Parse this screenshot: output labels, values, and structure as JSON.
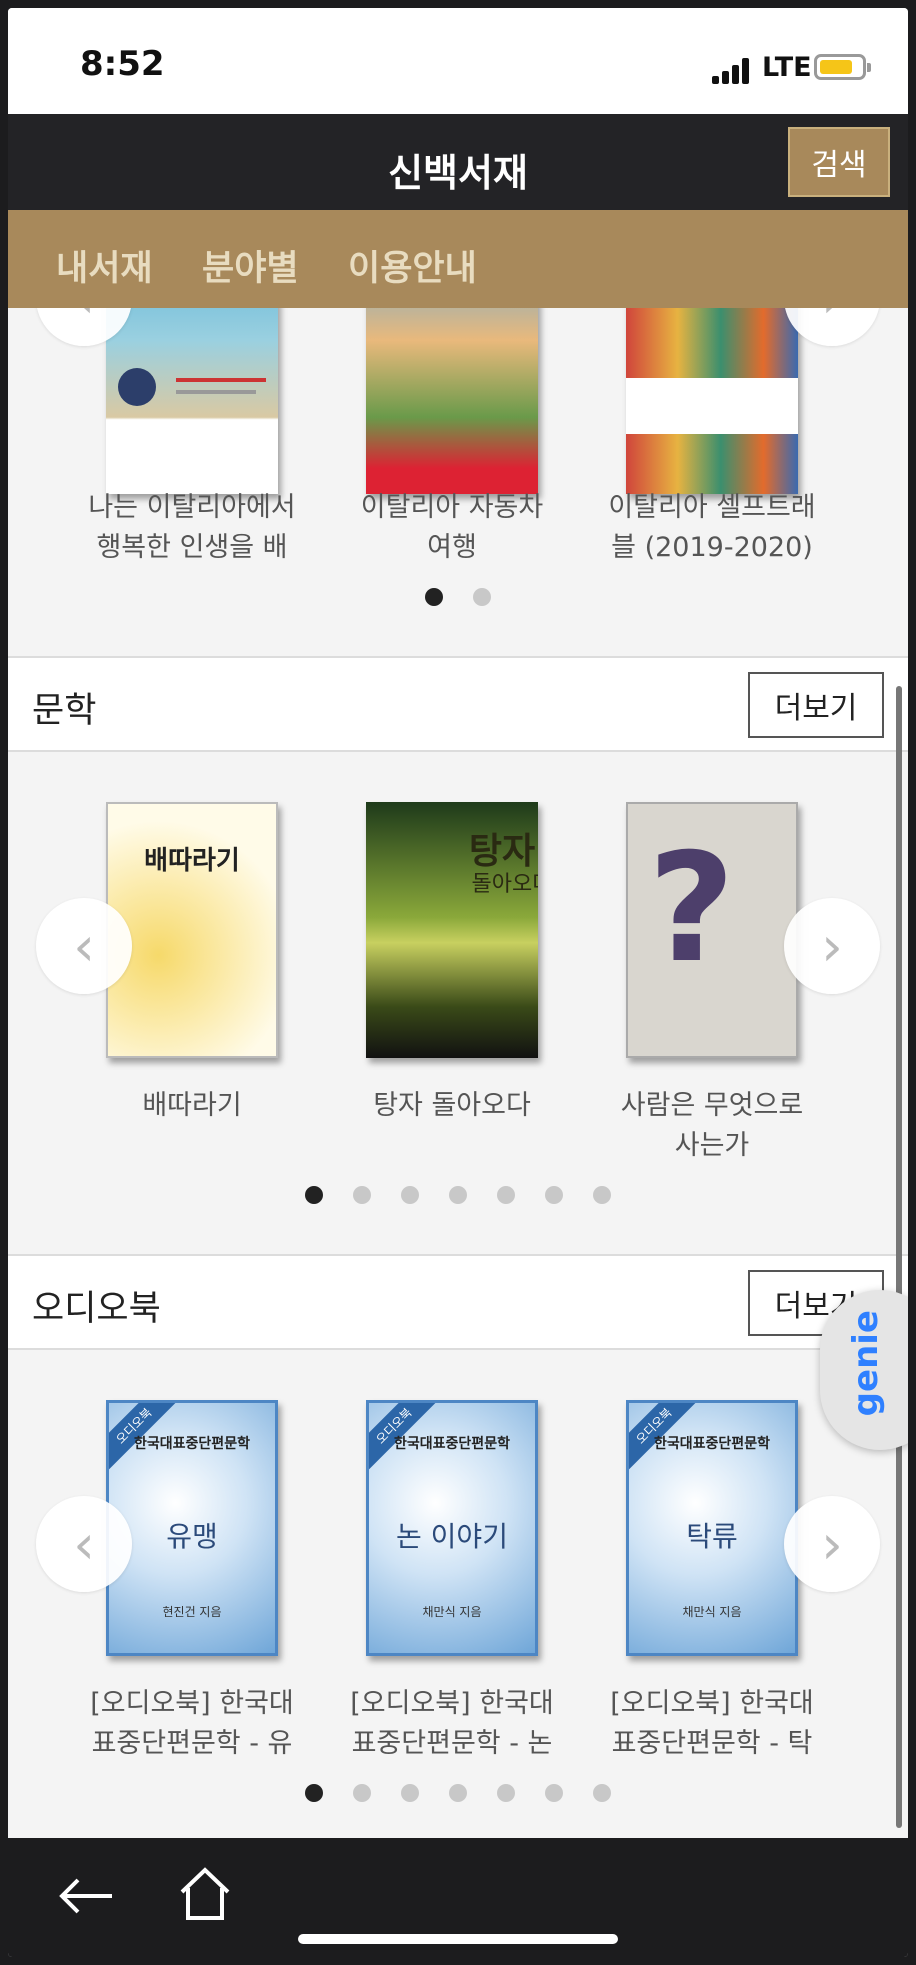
{
  "status_bar": {
    "time": "8:52",
    "network": "LTE"
  },
  "app": {
    "title": "신백서재",
    "search_label": "검색"
  },
  "menu": {
    "items": [
      "내서재",
      "분야별",
      "이용안내"
    ]
  },
  "top_carousel": {
    "books": [
      {
        "caption_line1": "나는 이탈리아에서",
        "caption_line2": "행복한 인생을 배"
      },
      {
        "caption_line1": "이탈리아 자동차",
        "caption_line2": "여행"
      },
      {
        "caption_line1": "이탈리아 셀프트래",
        "caption_line2": "블 (2019-2020)"
      }
    ],
    "page_count": 2,
    "active_page": 1
  },
  "literature": {
    "title": "문학",
    "more_label": "더보기",
    "books": [
      {
        "cover_title": "배따라기",
        "caption_line1": "배따라기",
        "caption_line2": ""
      },
      {
        "cover_title": "탕자",
        "cover_subtitle": "돌아오다",
        "caption_line1": "탕자 돌아오다",
        "caption_line2": ""
      },
      {
        "cover_title": "사람은 무엇으로 사는가",
        "caption_line1": "사람은 무엇으로",
        "caption_line2": "사는가"
      }
    ],
    "page_count": 7,
    "active_page": 1
  },
  "audiobook": {
    "title": "오디오북",
    "more_label": "더보기",
    "books": [
      {
        "series": "한국대표중단편문학",
        "cover_title": "유맹",
        "author": "현진건 지음",
        "caption_line1": "[오디오북] 한국대",
        "caption_line2": "표중단편문학 - 유"
      },
      {
        "series": "한국대표중단편문학",
        "cover_title": "논 이야기",
        "author": "채만식 지음",
        "caption_line1": "[오디오북] 한국대",
        "caption_line2": "표중단편문학 - 논"
      },
      {
        "series": "한국대표중단편문학",
        "cover_title": "탁류",
        "author": "채만식 지음",
        "caption_line1": "[오디오북] 한국대",
        "caption_line2": "표중단편문학 - 탁"
      }
    ],
    "badge": "오디오북",
    "page_count": 7,
    "active_page": 1
  },
  "genie_label": "genie",
  "colors": {
    "accent": "#a8895b",
    "appbar": "#232326"
  }
}
